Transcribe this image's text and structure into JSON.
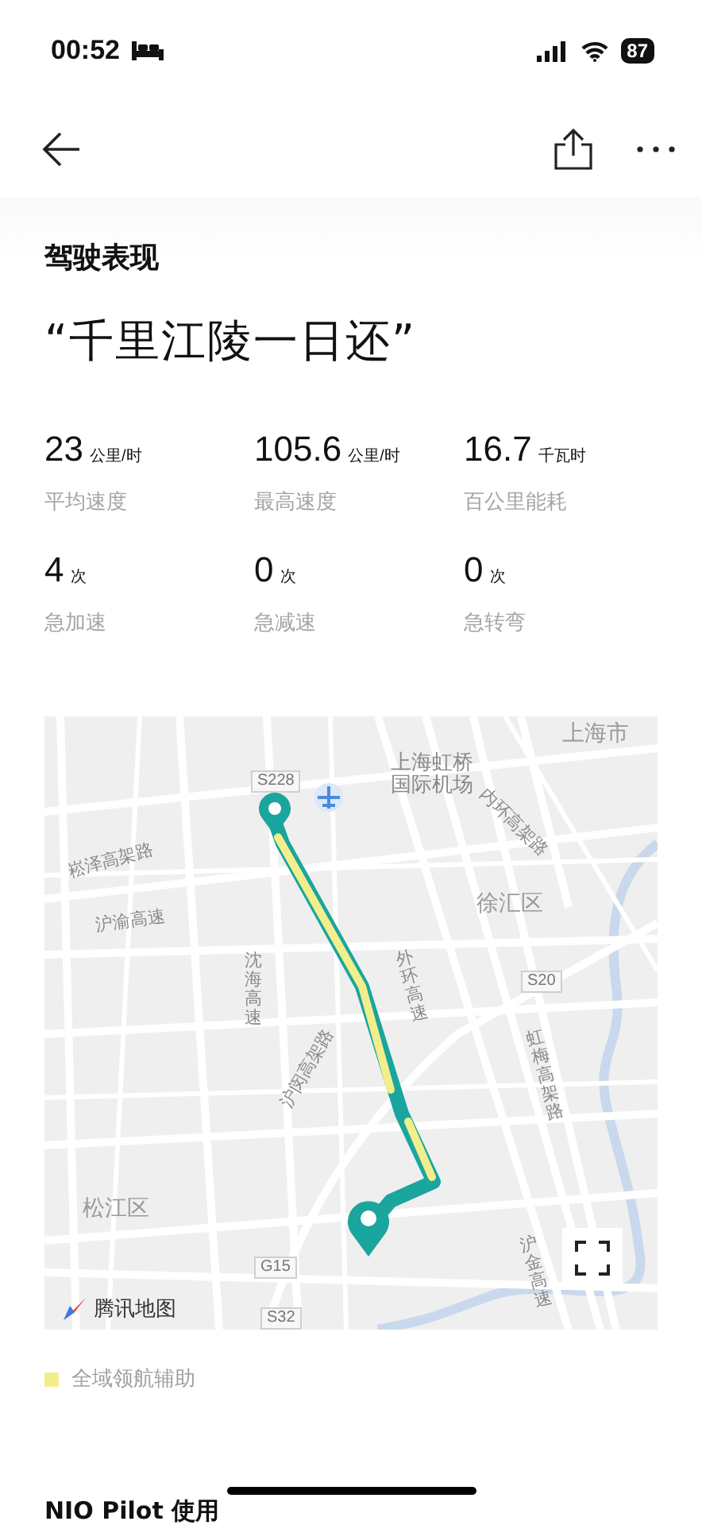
{
  "status_bar": {
    "time": "00:52",
    "battery": "87"
  },
  "section_title": "驾驶表现",
  "quote": "“千里江陵一日还”",
  "stats": [
    {
      "value": "23",
      "unit": "公里/时",
      "label": "平均速度"
    },
    {
      "value": "105.6",
      "unit": "公里/时",
      "label": "最高速度"
    },
    {
      "value": "16.7",
      "unit": "千瓦时",
      "label": "百公里能耗"
    },
    {
      "value": "4",
      "unit": "次",
      "label": "急加速"
    },
    {
      "value": "0",
      "unit": "次",
      "label": "急减速"
    },
    {
      "value": "0",
      "unit": "次",
      "label": "急转弯"
    }
  ],
  "map": {
    "labels": [
      {
        "text": "上海市",
        "kind": "place"
      },
      {
        "text": "S228",
        "kind": "shield"
      },
      {
        "text": "上海虹桥",
        "kind": "poi"
      },
      {
        "text": "国际机场",
        "kind": "poi"
      },
      {
        "text": "内环高架路",
        "kind": "road"
      },
      {
        "text": "崧泽高架路",
        "kind": "road"
      },
      {
        "text": "徐汇区",
        "kind": "place"
      },
      {
        "text": "沪渝高速",
        "kind": "road"
      },
      {
        "text": "沈海高速",
        "kind": "road"
      },
      {
        "text": "外环高速",
        "kind": "road"
      },
      {
        "text": "S20",
        "kind": "shield"
      },
      {
        "text": "虹梅高架路",
        "kind": "road"
      },
      {
        "text": "沪闵高架路",
        "kind": "road"
      },
      {
        "text": "松江区",
        "kind": "place"
      },
      {
        "text": "沪金高速",
        "kind": "road"
      },
      {
        "text": "G15",
        "kind": "shield"
      },
      {
        "text": "S32",
        "kind": "shield"
      }
    ],
    "provider": "腾讯地图"
  },
  "legend": [
    {
      "label": "全域领航辅助",
      "color": "#f3ee8c"
    }
  ],
  "next_section_title": "NIO Pilot 使用"
}
